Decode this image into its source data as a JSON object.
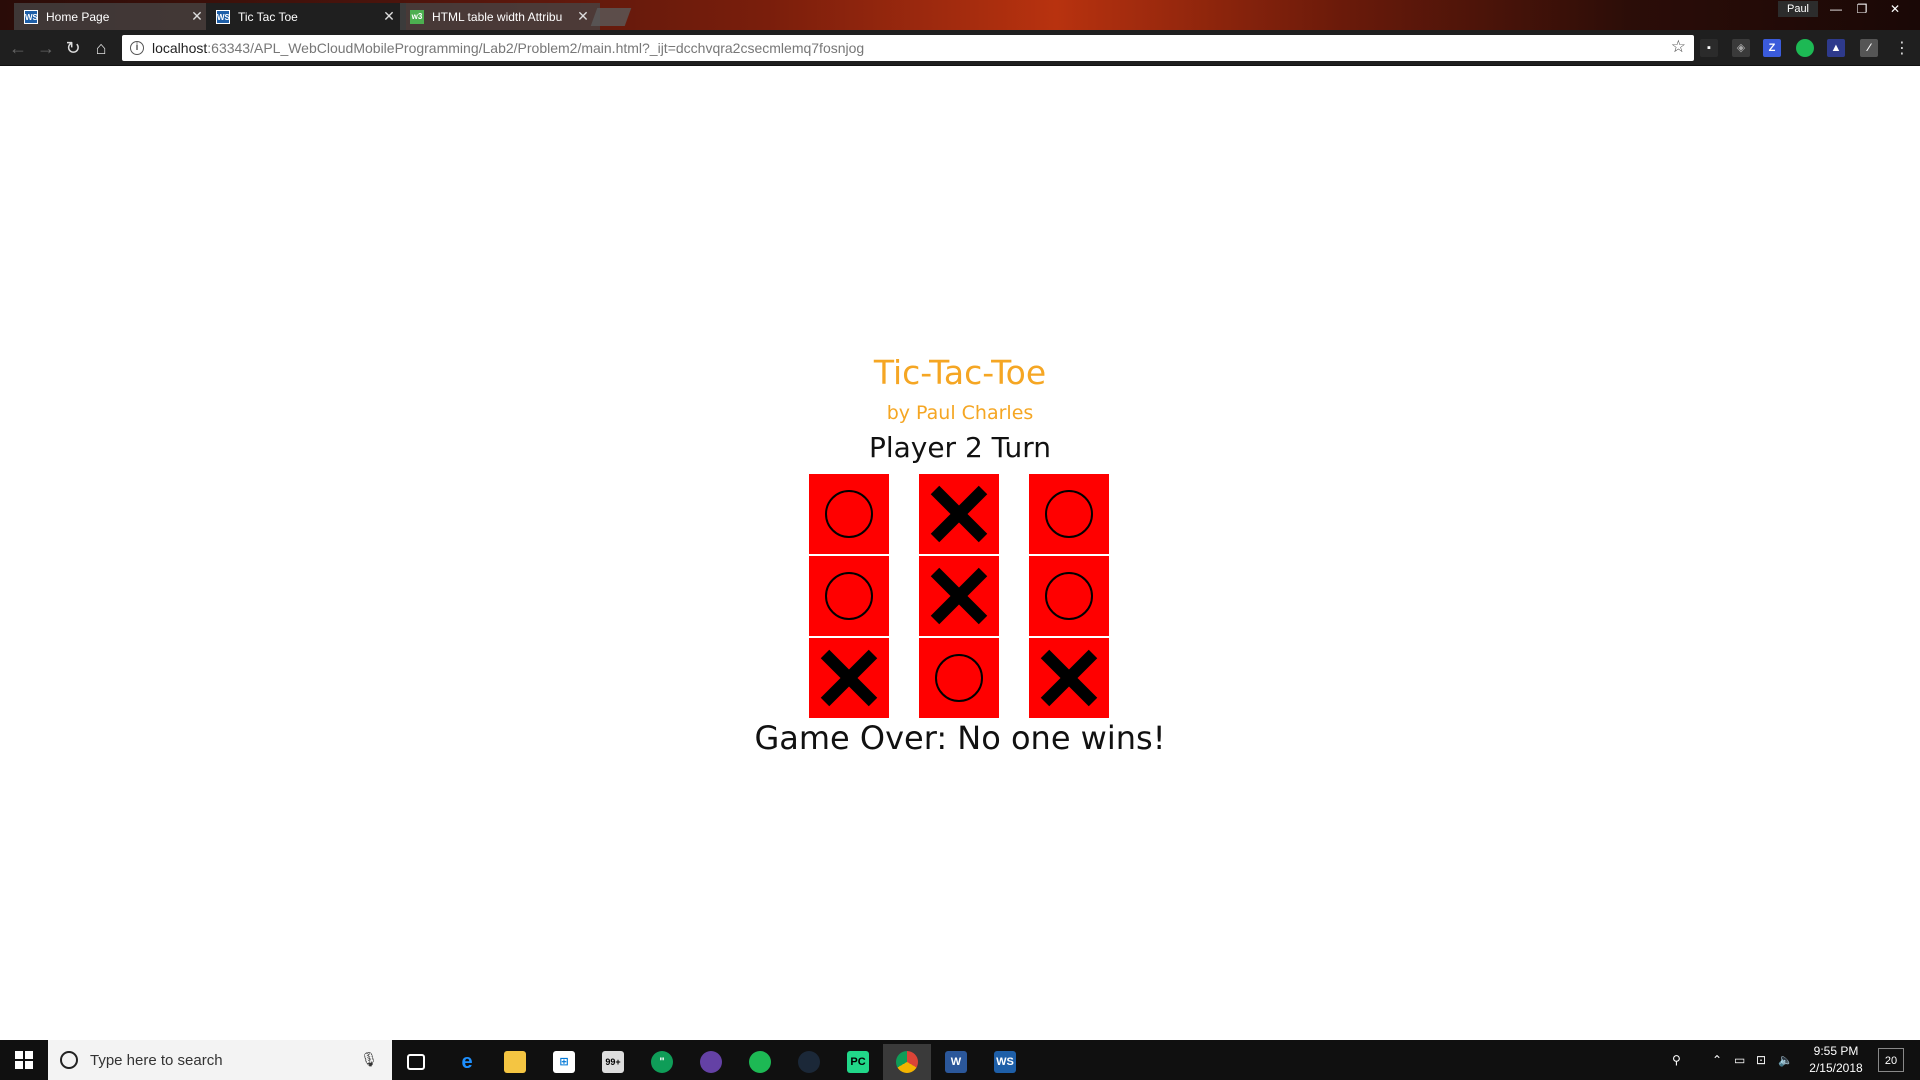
{
  "browser": {
    "tabs": [
      {
        "label": "Home Page",
        "favicon": "WS",
        "active": false
      },
      {
        "label": "Tic Tac Toe",
        "favicon": "WS",
        "active": true
      },
      {
        "label": "HTML table width Attribu",
        "favicon": "w3",
        "active": false
      }
    ],
    "profile": "Paul",
    "url_host": "localhost",
    "url_path": ":63343/APL_WebCloudMobileProgramming/Lab2/Problem2/main.html?_ijt=dcchvqra2csecmlemq7fosnjog"
  },
  "game": {
    "title": "Tic-Tac-Toe",
    "byline": "by Paul Charles",
    "turn": "Player 2 Turn",
    "board": [
      [
        "O",
        "X",
        "O"
      ],
      [
        "O",
        "X",
        "O"
      ],
      [
        "X",
        "O",
        "X"
      ]
    ],
    "result": "Game Over: No one wins!",
    "colors": {
      "cell": "#ff0000",
      "title": "#f5a623",
      "mark": "#000000"
    }
  },
  "taskbar": {
    "search_placeholder": "Type here to search",
    "time": "9:55 PM",
    "date": "2/15/2018",
    "notifications": "20",
    "mail_badge": "99+"
  }
}
